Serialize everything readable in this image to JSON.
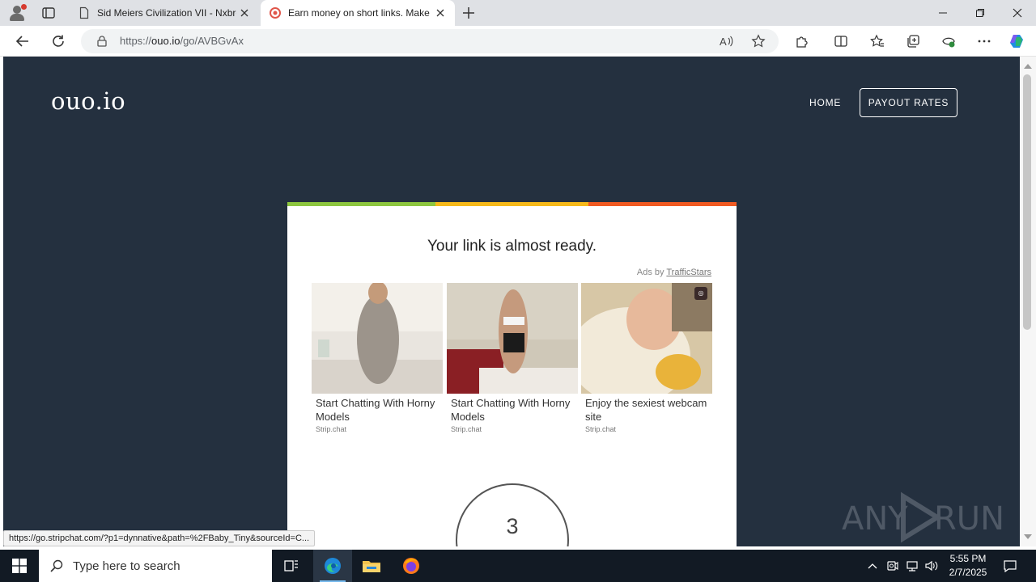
{
  "browser": {
    "tabs": [
      {
        "title": "Sid Meiers Civilization VII - Nxbre",
        "active": false
      },
      {
        "title": "Earn money on short links. Make",
        "active": true
      }
    ],
    "url_prefix": "https://",
    "url_domain": "ouo.io",
    "url_path": "/go/AVBGvAx"
  },
  "site": {
    "logo": "ouo.io",
    "nav": {
      "home": "HOME",
      "payout": "PAYOUT RATES"
    }
  },
  "card": {
    "heading": "Your link is almost ready.",
    "ads_by_prefix": "Ads by ",
    "ads_by_link": "TrafficStars",
    "ads": [
      {
        "title": "Start Chatting With Horny Models",
        "source": "Strip.chat"
      },
      {
        "title": "Start Chatting With Horny Models",
        "source": "Strip.chat"
      },
      {
        "title": "Enjoy the sexiest webcam site",
        "source": "Strip.chat"
      }
    ],
    "countdown": "3"
  },
  "status_url": "https://go.stripchat.com/?p1=dynnative&path=%2FBaby_Tiny&sourceId=C...",
  "watermark": "ANY RUN",
  "taskbar": {
    "search_placeholder": "Type here to search",
    "time": "5:55 PM",
    "date": "2/7/2025"
  },
  "colors": {
    "page_bg": "#24303f",
    "bar_green": "#8dc63f",
    "bar_yellow": "#f6b91a",
    "bar_orange": "#f05a22"
  }
}
